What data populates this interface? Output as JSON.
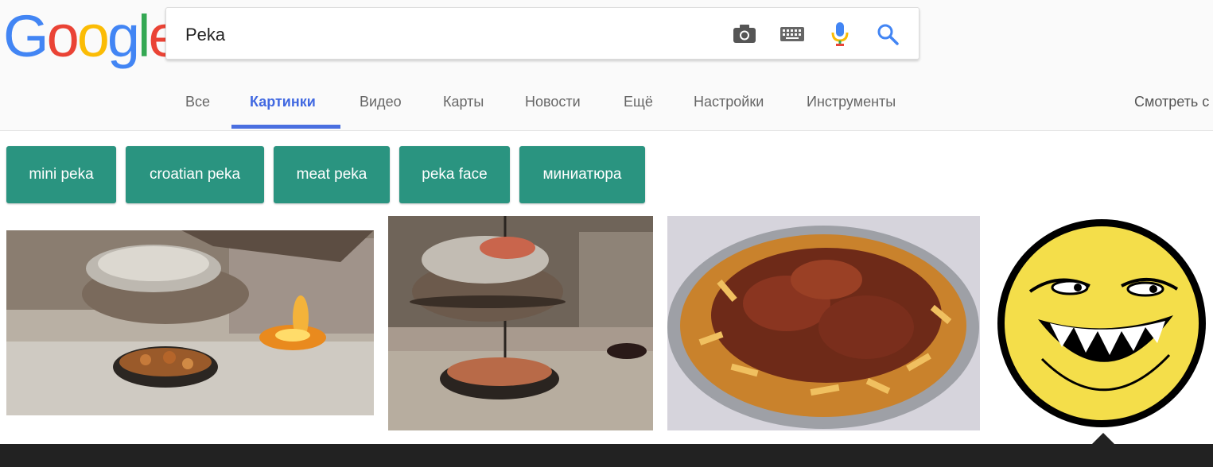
{
  "logo": {
    "letters": [
      "G",
      "o",
      "o",
      "g",
      "l",
      "e"
    ],
    "colors": [
      "#4285F4",
      "#EA4335",
      "#FBBC05",
      "#4285F4",
      "#34A853",
      "#EA4335"
    ]
  },
  "search": {
    "value": "Peka",
    "icons": [
      "camera-icon",
      "keyboard-icon",
      "mic-icon",
      "search-icon"
    ]
  },
  "tabs": [
    {
      "label": "Все"
    },
    {
      "label": "Картинки"
    },
    {
      "label": "Видео"
    },
    {
      "label": "Карты"
    },
    {
      "label": "Новости"
    },
    {
      "label": "Ещё"
    },
    {
      "label": "Настройки"
    },
    {
      "label": "Инструменты"
    }
  ],
  "safe_search_label": "Смотреть с",
  "chips": [
    {
      "label": "mini peka"
    },
    {
      "label": "croatian peka"
    },
    {
      "label": "meat peka"
    },
    {
      "label": "peka face"
    },
    {
      "label": "миниатюра"
    }
  ],
  "colors": {
    "accent": "#4169e1",
    "chip": "#2a9480"
  }
}
